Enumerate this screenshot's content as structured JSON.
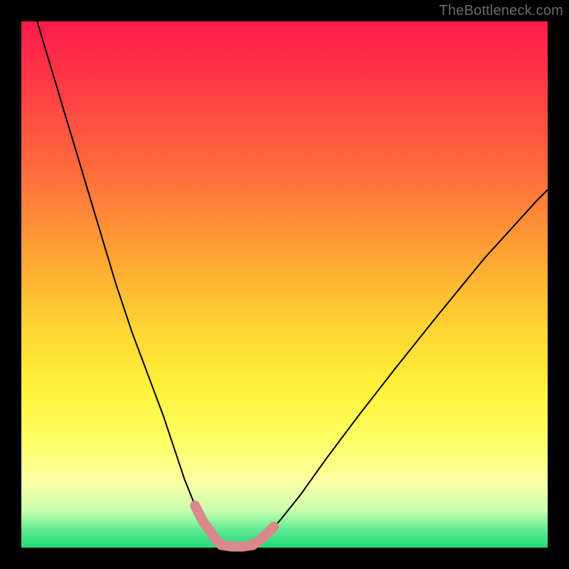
{
  "watermark": {
    "text": "TheBottleneck.com"
  },
  "colors": {
    "curve_stroke": "#000000",
    "accent_stroke": "#d9888c",
    "bg_black": "#000000"
  },
  "chart_data": {
    "type": "line",
    "title": "",
    "xlabel": "",
    "ylabel": "",
    "xlim": [
      0,
      100
    ],
    "ylim": [
      0,
      100
    ],
    "grid": false,
    "legend": false,
    "series": [
      {
        "name": "left-curve",
        "x": [
          3,
          6,
          9,
          12,
          15,
          18,
          21,
          24,
          27,
          29,
          31,
          33,
          34.5,
          36,
          37,
          38
        ],
        "values": [
          100,
          90,
          80,
          70,
          60,
          50,
          41,
          33,
          25,
          19,
          13,
          8,
          5,
          3,
          1.5,
          0.5
        ]
      },
      {
        "name": "right-curve",
        "x": [
          44,
          46,
          49,
          53,
          58,
          64,
          71,
          79,
          88,
          98,
          100
        ],
        "values": [
          0.5,
          2,
          5,
          10,
          17,
          25,
          34,
          44,
          55,
          66,
          68
        ]
      },
      {
        "name": "valley-floor",
        "x": [
          38,
          40,
          42,
          44
        ],
        "values": [
          0.5,
          0.2,
          0.2,
          0.5
        ]
      },
      {
        "name": "accent-left",
        "x": [
          33,
          34.5,
          36,
          37,
          38
        ],
        "values": [
          8,
          5,
          3,
          1.5,
          0.5
        ]
      },
      {
        "name": "accent-floor",
        "x": [
          38,
          40,
          42,
          44
        ],
        "values": [
          0.5,
          0.2,
          0.2,
          0.5
        ]
      },
      {
        "name": "accent-right",
        "x": [
          44,
          46,
          48
        ],
        "values": [
          0.5,
          2,
          4
        ]
      }
    ]
  }
}
